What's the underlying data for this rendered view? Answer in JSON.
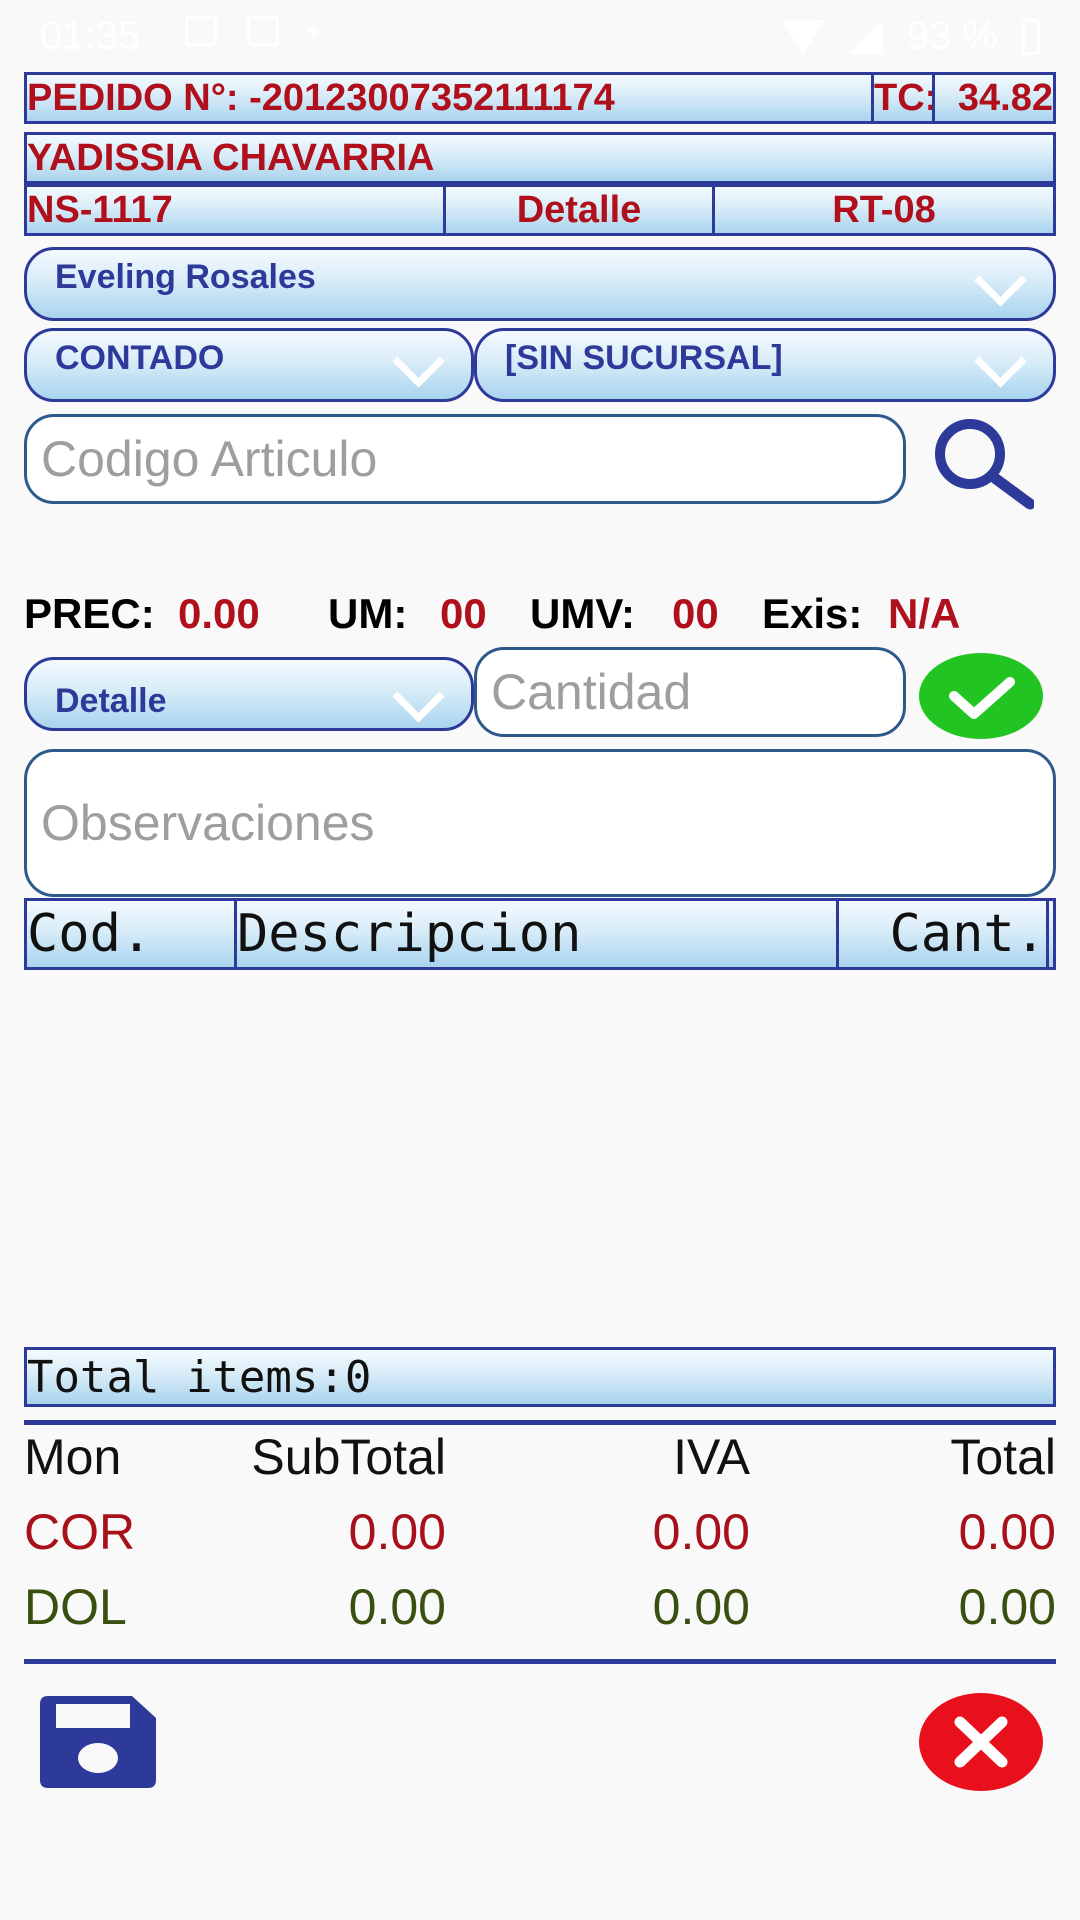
{
  "status_bar": {
    "time": "01:35",
    "battery": "93 %"
  },
  "header": {
    "pedido_label": "PEDIDO N°: -20123007352111174",
    "tc_label": "TC:",
    "tc_value": "34.82",
    "client_name": "YADISSIA CHAVARRIA",
    "code": "NS-1117",
    "price_type": "Detalle",
    "route": "RT-08"
  },
  "dropdowns": {
    "seller": "Eveling Rosales",
    "payment": "CONTADO",
    "branch": "[SIN SUCURSAL]",
    "detail": "Detalle"
  },
  "inputs": {
    "article_placeholder": "Codigo Articulo",
    "quantity_placeholder": "Cantidad",
    "observations_placeholder": "Observaciones"
  },
  "price_row": {
    "prec_label": "PREC:",
    "prec_value": "0.00",
    "um_label": "UM:",
    "um_value": "00",
    "umv_label": "UMV:",
    "umv_value": "00",
    "exis_label": "Exis:",
    "exis_value": "N/A"
  },
  "table": {
    "columns": [
      "Cod.",
      "Descripcion",
      "Cant."
    ],
    "rows": []
  },
  "total_items": "Total items:0",
  "summary": {
    "headers": [
      "Mon",
      "SubTotal",
      "IVA",
      "Total"
    ],
    "rows": [
      {
        "mon": "COR",
        "subtotal": "0.00",
        "iva": "0.00",
        "total": "0.00",
        "color": "#a8101a"
      },
      {
        "mon": "DOL",
        "subtotal": "0.00",
        "iva": "0.00",
        "total": "0.00",
        "color": "#3a5010"
      }
    ]
  },
  "colors": {
    "accent_blue": "#2d3a9a",
    "header_red": "#b0101c",
    "confirm_green": "#22c422",
    "cancel_red": "#e8101c"
  },
  "icons": {
    "search": "search-icon",
    "confirm": "check-icon",
    "save": "save-icon",
    "cancel": "close-icon"
  }
}
